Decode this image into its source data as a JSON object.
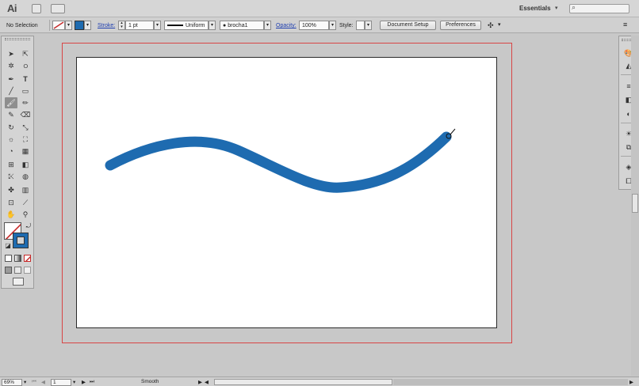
{
  "app": {
    "logo": "Ai",
    "workspace": "Essentials"
  },
  "search": {
    "placeholder": ""
  },
  "control_bar": {
    "selection": "No Selection",
    "stroke_label": "Stroke:",
    "stroke_weight": "1 pt",
    "profile": "Uniform",
    "brush": "brocha1",
    "opacity_label": "Opacity:",
    "opacity_value": "100%",
    "style_label": "Style:",
    "document_setup": "Document Setup",
    "preferences": "Preferences"
  },
  "status_bar": {
    "zoom": "69%",
    "artboard_number": "1",
    "status_text": "Smooth"
  },
  "colors": {
    "brush_stroke": "#1e6bb0",
    "bleed_line": "#d84545",
    "artboard": "#ffffff",
    "pasteboard": "#c8c8c8"
  },
  "tools": [
    "selection-tool",
    "direct-selection-tool",
    "magic-wand-tool",
    "lasso-tool",
    "pen-tool",
    "type-tool",
    "line-tool",
    "rectangle-tool",
    "paintbrush-tool",
    "pencil-tool",
    "blob-brush-tool",
    "eraser-tool",
    "rotate-tool",
    "scale-tool",
    "warp-tool",
    "free-transform-tool",
    "shape-builder-tool",
    "perspective-grid-tool",
    "mesh-tool",
    "gradient-tool",
    "eyedropper-tool",
    "blend-tool",
    "symbol-sprayer-tool",
    "column-graph-tool",
    "artboard-tool",
    "slice-tool",
    "hand-tool",
    "zoom-tool"
  ]
}
